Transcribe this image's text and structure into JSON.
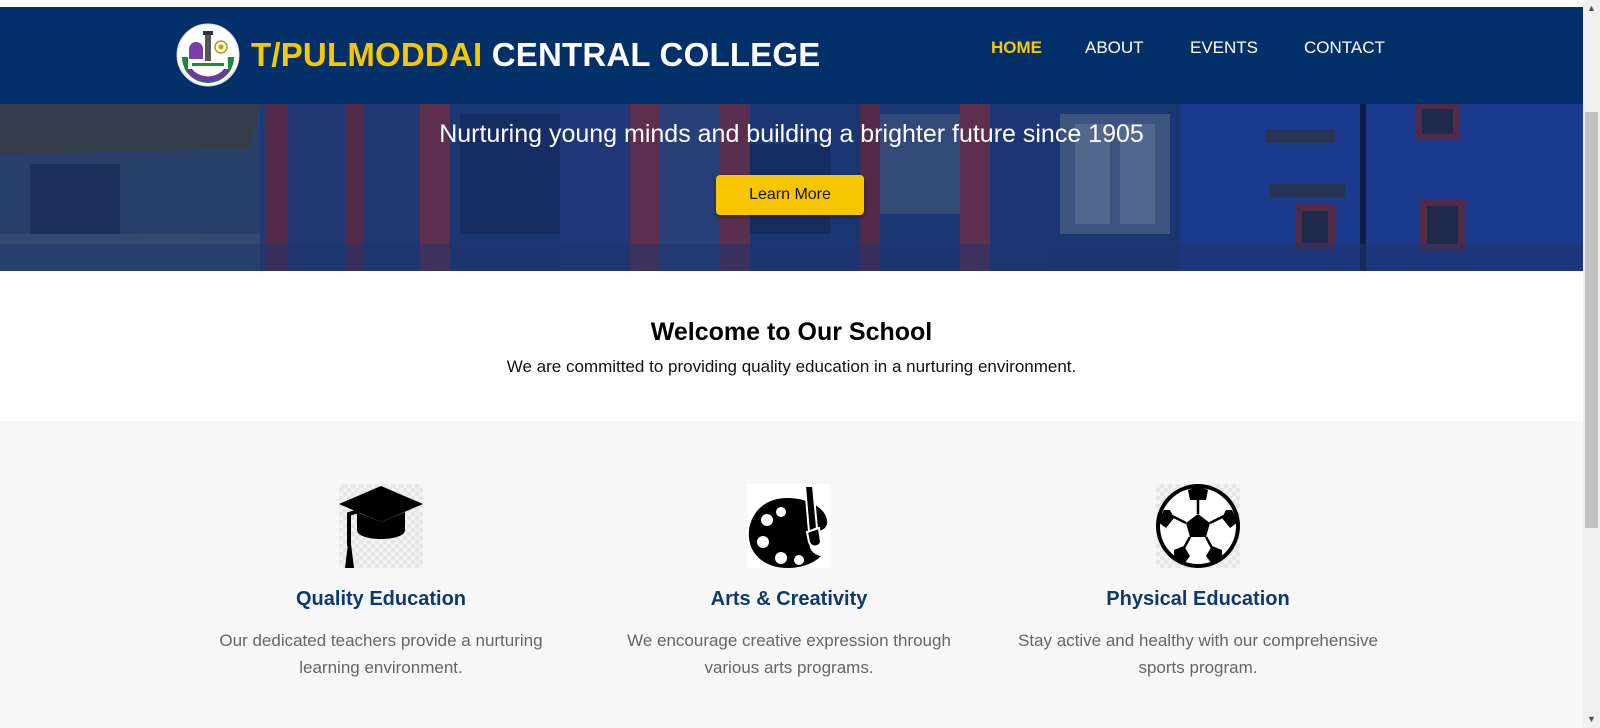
{
  "header": {
    "brand_accent": "T/PULMODDAI",
    "brand_rest": "CENTRAL COLLEGE",
    "nav": [
      {
        "label": "HOME",
        "active": true
      },
      {
        "label": "ABOUT",
        "active": false
      },
      {
        "label": "EVENTS",
        "active": false
      },
      {
        "label": "CONTACT",
        "active": false
      }
    ]
  },
  "hero": {
    "tagline": "Nurturing young minds and building a brighter future since 1905",
    "button_label": "Learn More"
  },
  "welcome": {
    "title": "Welcome to Our School",
    "subtitle": "We are committed to providing quality education in a nurturing environment."
  },
  "features": [
    {
      "icon": "graduation-cap-icon",
      "title": "Quality Education",
      "text": "Our dedicated teachers provide a nurturing learning environment."
    },
    {
      "icon": "paint-palette-icon",
      "title": "Arts & Creativity",
      "text": "We encourage creative expression through various arts programs."
    },
    {
      "icon": "soccer-ball-icon",
      "title": "Physical Education",
      "text": "Stay active and healthy with our comprehensive sports program."
    }
  ],
  "colors": {
    "header_bg": "#04306a",
    "accent_yellow": "#f5c800",
    "feature_title": "#0c3a6c"
  }
}
